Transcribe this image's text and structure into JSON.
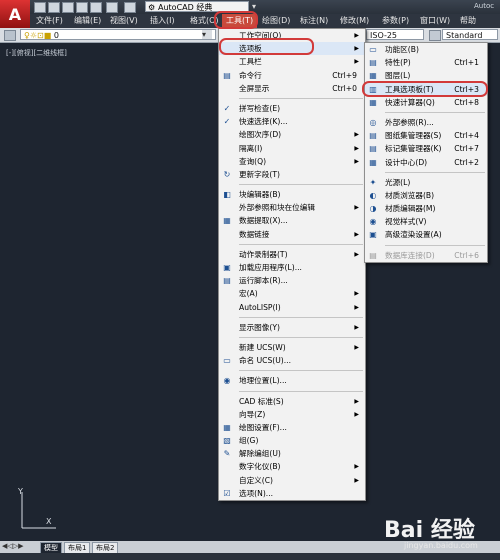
{
  "window": {
    "app_name": "Autoc"
  },
  "quick_access": {
    "workspace": "AutoCAD 经典"
  },
  "menubar": [
    "文件(F)",
    "编辑(E)",
    "视图(V)",
    "插入(I)",
    "格式(O)",
    "工具(T)",
    "绘图(D)",
    "标注(N)",
    "修改(M)",
    "参数(P)",
    "窗口(W)",
    "帮助"
  ],
  "toolbar": {
    "layer": "0",
    "dimstyle": "ISO-25",
    "textstyle": "Standard"
  },
  "viewport": {
    "label": "[-][俯视][二维线框]"
  },
  "tools_menu": [
    {
      "type": "item",
      "label": "工作空间(O)",
      "submenu": true,
      "icon": ""
    },
    {
      "type": "item",
      "label": "选项板",
      "submenu": true,
      "icon": "",
      "ring": true
    },
    {
      "type": "item",
      "label": "工具栏",
      "submenu": true,
      "icon": ""
    },
    {
      "type": "item",
      "label": "命令行",
      "shortcut": "Ctrl+9",
      "icon": "▤"
    },
    {
      "type": "item",
      "label": "全屏显示",
      "shortcut": "Ctrl+0",
      "icon": ""
    },
    {
      "type": "sep"
    },
    {
      "type": "item",
      "label": "拼写检查(E)",
      "icon": "✓"
    },
    {
      "type": "item",
      "label": "快速选择(K)...",
      "icon": "✓"
    },
    {
      "type": "item",
      "label": "绘图次序(D)",
      "submenu": true,
      "icon": ""
    },
    {
      "type": "item",
      "label": "隔离(I)",
      "submenu": true,
      "icon": ""
    },
    {
      "type": "item",
      "label": "查询(Q)",
      "submenu": true,
      "icon": ""
    },
    {
      "type": "item",
      "label": "更新字段(T)",
      "icon": "↻"
    },
    {
      "type": "sep"
    },
    {
      "type": "item",
      "label": "块编辑器(B)",
      "icon": "◧"
    },
    {
      "type": "item",
      "label": "外部参照和块在位编辑",
      "submenu": true,
      "icon": ""
    },
    {
      "type": "item",
      "label": "数据提取(X)...",
      "icon": "▦"
    },
    {
      "type": "item",
      "label": "数据链接",
      "submenu": true,
      "icon": ""
    },
    {
      "type": "sep"
    },
    {
      "type": "item",
      "label": "动作录制器(T)",
      "submenu": true,
      "icon": ""
    },
    {
      "type": "item",
      "label": "加载应用程序(L)...",
      "icon": "▣"
    },
    {
      "type": "item",
      "label": "运行脚本(R)...",
      "icon": "▤"
    },
    {
      "type": "item",
      "label": "宏(A)",
      "submenu": true,
      "icon": ""
    },
    {
      "type": "item",
      "label": "AutoLISP(I)",
      "submenu": true,
      "icon": ""
    },
    {
      "type": "sep"
    },
    {
      "type": "item",
      "label": "显示图像(Y)",
      "submenu": true,
      "icon": ""
    },
    {
      "type": "sep"
    },
    {
      "type": "item",
      "label": "新建 UCS(W)",
      "submenu": true,
      "icon": ""
    },
    {
      "type": "item",
      "label": "命名 UCS(U)...",
      "icon": "▭"
    },
    {
      "type": "sep"
    },
    {
      "type": "item",
      "label": "地理位置(L)...",
      "icon": "◉"
    },
    {
      "type": "sep"
    },
    {
      "type": "item",
      "label": "CAD 标准(S)",
      "submenu": true,
      "icon": ""
    },
    {
      "type": "item",
      "label": "向导(Z)",
      "submenu": true,
      "icon": ""
    },
    {
      "type": "item",
      "label": "绘图设置(F)...",
      "icon": "▦"
    },
    {
      "type": "item",
      "label": "组(G)",
      "icon": "▧"
    },
    {
      "type": "item",
      "label": "解除编组(U)",
      "icon": "✎"
    },
    {
      "type": "item",
      "label": "数字化仪(B)",
      "submenu": true,
      "icon": ""
    },
    {
      "type": "item",
      "label": "自定义(C)",
      "submenu": true,
      "icon": ""
    },
    {
      "type": "item",
      "label": "选项(N)...",
      "icon": "☑"
    }
  ],
  "palettes_menu": [
    {
      "type": "item",
      "label": "功能区(B)",
      "icon": "▭"
    },
    {
      "type": "item",
      "label": "特性(P)",
      "shortcut": "Ctrl+1",
      "icon": "▤"
    },
    {
      "type": "item",
      "label": "图层(L)",
      "icon": "▦"
    },
    {
      "type": "item",
      "label": "工具选项板(T)",
      "shortcut": "Ctrl+3",
      "icon": "▥",
      "ring": true
    },
    {
      "type": "item",
      "label": "快速计算器(Q)",
      "shortcut": "Ctrl+8",
      "icon": "▦"
    },
    {
      "type": "sep"
    },
    {
      "type": "item",
      "label": "外部参照(R)...",
      "icon": "◎"
    },
    {
      "type": "item",
      "label": "图纸集管理器(S)",
      "shortcut": "Ctrl+4",
      "icon": "▤"
    },
    {
      "type": "item",
      "label": "标记集管理器(K)",
      "shortcut": "Ctrl+7",
      "icon": "▤"
    },
    {
      "type": "item",
      "label": "设计中心(D)",
      "shortcut": "Ctrl+2",
      "icon": "▦"
    },
    {
      "type": "sep"
    },
    {
      "type": "item",
      "label": "光源(L)",
      "icon": "✦"
    },
    {
      "type": "item",
      "label": "材质浏览器(B)",
      "icon": "◐"
    },
    {
      "type": "item",
      "label": "材质编辑器(M)",
      "icon": "◑"
    },
    {
      "type": "item",
      "label": "视觉样式(V)",
      "icon": "◉"
    },
    {
      "type": "item",
      "label": "高级渲染设置(A)",
      "icon": "▣"
    },
    {
      "type": "sep"
    },
    {
      "type": "item",
      "label": "数据库连接(D)",
      "shortcut": "Ctrl+6",
      "icon": "▤",
      "disabled": true
    }
  ],
  "bottom_tabs": [
    "模型",
    "布局1",
    "布局2"
  ],
  "watermark": {
    "main": "Bai 经验",
    "sub": "jingyan.baidu.com"
  }
}
